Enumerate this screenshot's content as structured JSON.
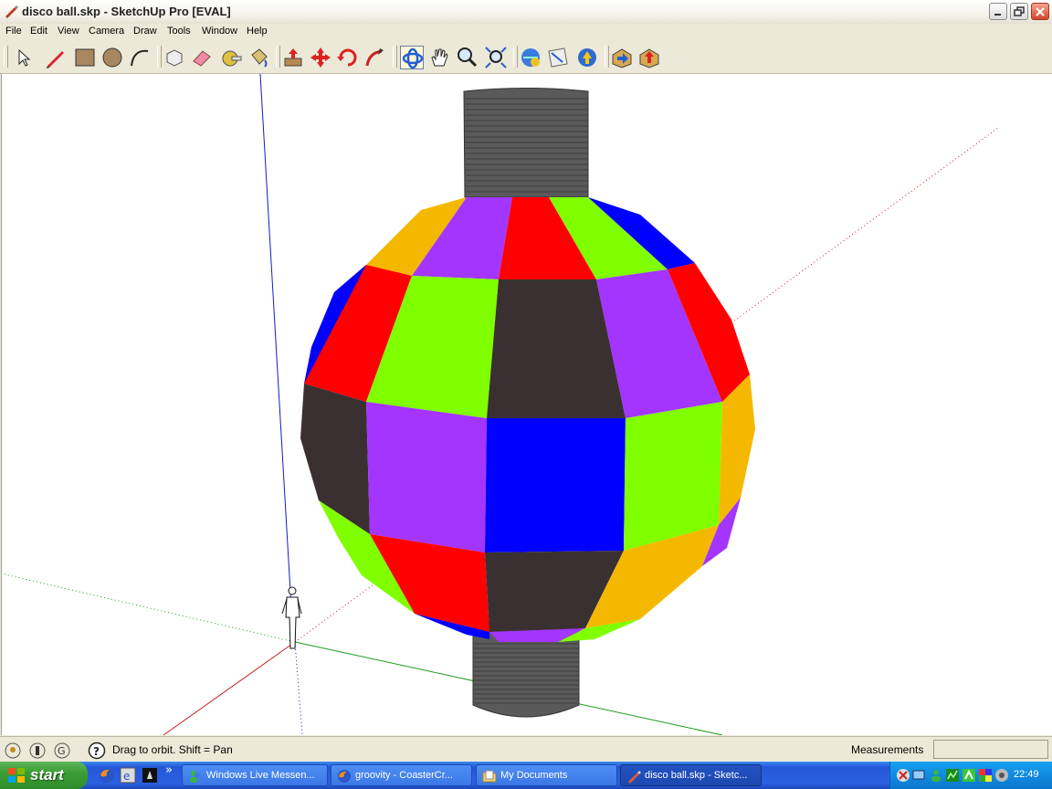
{
  "window": {
    "title": "disco ball.skp - SketchUp Pro [EVAL]"
  },
  "menu": [
    "File",
    "Edit",
    "View",
    "Camera",
    "Draw",
    "Tools",
    "Window",
    "Help"
  ],
  "toolbar": {
    "tools": [
      "select-icon",
      "pencil-icon",
      "rectangle-icon",
      "circle-icon",
      "arc-icon",
      "make-component-icon",
      "eraser-icon",
      "tape-measure-icon",
      "paint-bucket-icon",
      "push-pull-icon",
      "move-icon",
      "rotate-icon",
      "follow-me-icon",
      "orbit-icon",
      "pan-icon",
      "zoom-icon",
      "zoom-extents-icon",
      "get-models-icon",
      "share-model-icon",
      "google-earth-icon",
      "get-current-view-icon",
      "toggle-terrain-icon"
    ],
    "active_tool": "orbit-icon"
  },
  "status": {
    "hint": "Drag to orbit.  Shift = Pan",
    "measurements_label": "Measurements",
    "measurements_value": ""
  },
  "taskbar": {
    "start_label": "start",
    "chevron": "»",
    "tasks": [
      {
        "label": "Windows Live Messen...",
        "icon": "messenger-icon",
        "active": false
      },
      {
        "label": "groovity - CoasterCr...",
        "icon": "firefox-icon",
        "active": false
      },
      {
        "label": "My Documents",
        "icon": "folder-icon",
        "active": false
      },
      {
        "label": "disco ball.skp - Sketc...",
        "icon": "sketchup-icon",
        "active": true
      }
    ],
    "clock": "22:49"
  },
  "colors": {
    "red": "#ff0000",
    "green": "#7fff00",
    "blue": "#0000ff",
    "purple": "#a335ff",
    "dark": "#3a3032",
    "orange": "#f5b800",
    "cylinder": "#5a5a5a"
  }
}
